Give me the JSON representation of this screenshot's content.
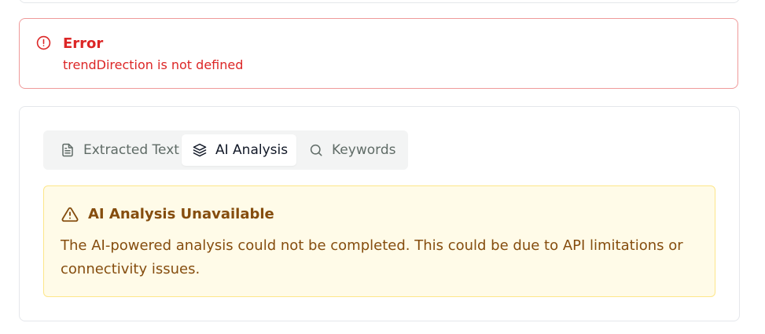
{
  "error": {
    "title": "Error",
    "message": "trendDirection is not defined",
    "icon": "alert-circle-icon",
    "color": "#dc2626"
  },
  "tabs": [
    {
      "label": "Extracted Text",
      "icon": "file-text-icon",
      "active": false
    },
    {
      "label": "AI Analysis",
      "icon": "layers-icon",
      "active": true
    },
    {
      "label": "Keywords",
      "icon": "search-icon",
      "active": false
    }
  ],
  "alert": {
    "title": "AI Analysis Unavailable",
    "description": "The AI-powered analysis could not be completed. This could be due to API limitations or connectivity issues.",
    "icon": "alert-triangle-icon",
    "color": "#854d0e",
    "background": "#fffbe8"
  }
}
